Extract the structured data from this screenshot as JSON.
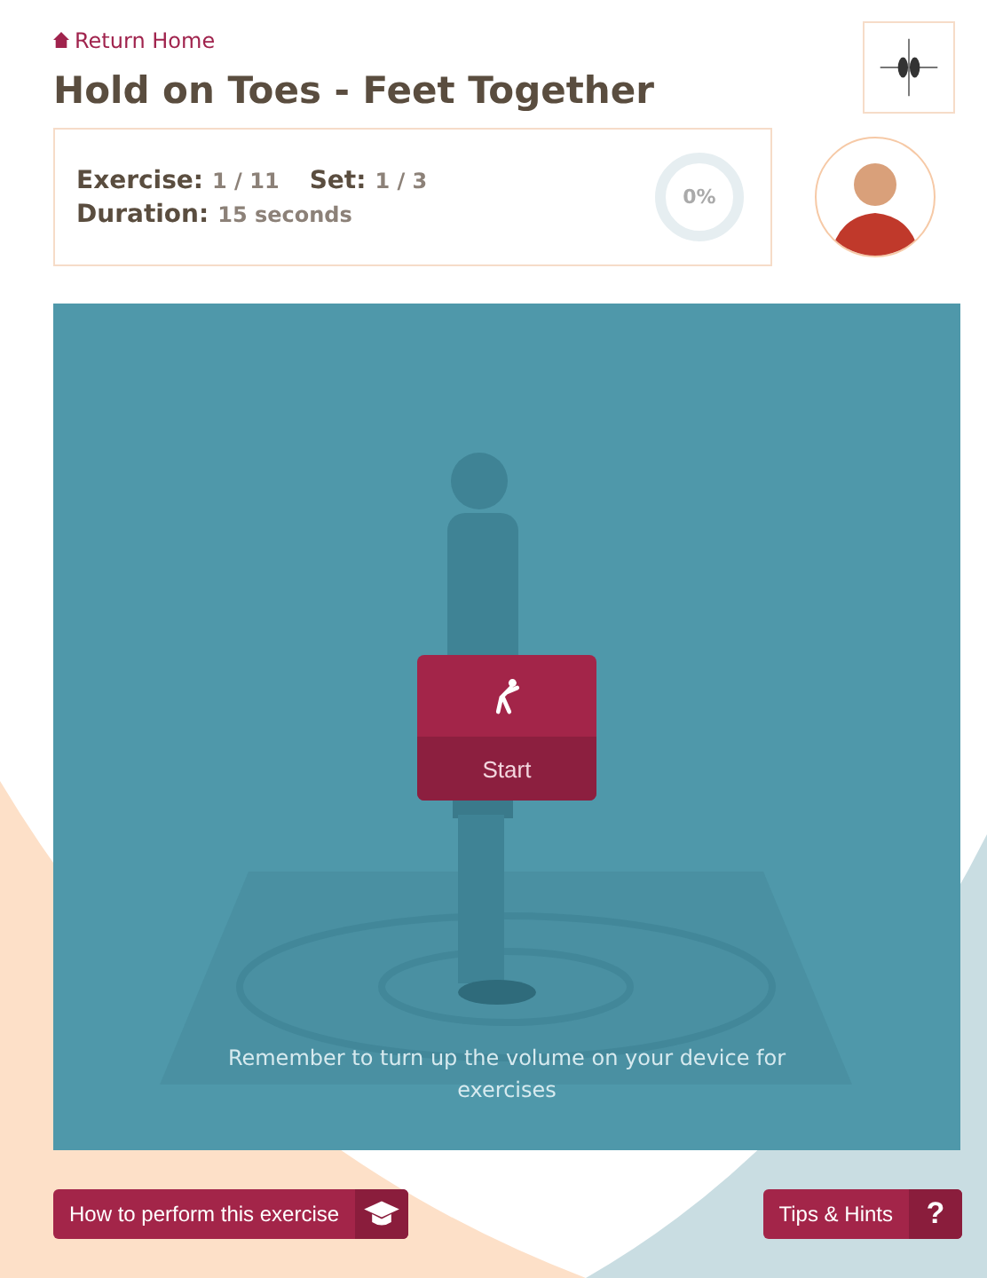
{
  "header": {
    "back_link": "Return Home",
    "title": "Hold on Toes - Feet Together"
  },
  "stats": {
    "exercise_label": "Exercise:",
    "exercise_value": "1 / 11",
    "set_label": "Set:",
    "set_value": "1 / 3",
    "duration_label": "Duration:",
    "duration_value": "15 seconds"
  },
  "progress": {
    "label": "0%"
  },
  "video": {
    "start_button": "Start",
    "reminder": "Remember to turn up the volume on your device for exercises"
  },
  "footer": {
    "how_button": "How to perform this exercise",
    "tips_button": "Tips & Hints",
    "tips_icon": "?"
  }
}
